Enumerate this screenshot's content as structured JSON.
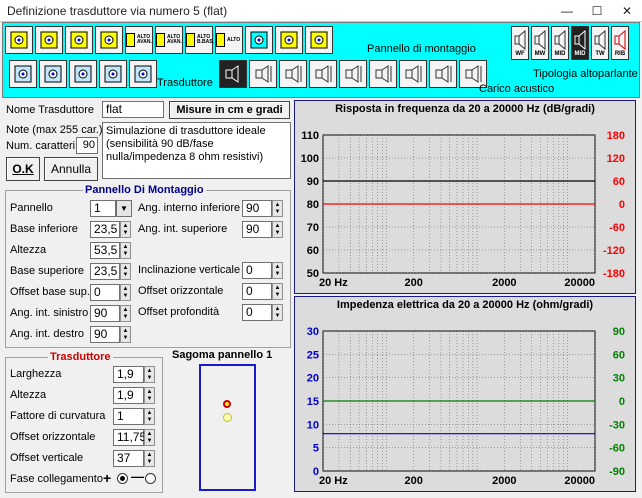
{
  "window": {
    "title": "Definizione trasduttore via numero 5 (flat)",
    "min": "—",
    "max": "☐",
    "close": "✕"
  },
  "toolbar": {
    "mount_label": "Pannello di montaggio",
    "transducer_label": "Trasduttore",
    "acoustic_label": "Carico acustico",
    "type_label": "Tipologia altoparlante",
    "mount_buttons": [
      {
        "icon": "panel-offset-icon",
        "text": ""
      },
      {
        "icon": "panel-center-icon",
        "text": ""
      },
      {
        "icon": "panel-corner-icon",
        "text": ""
      },
      {
        "icon": "panel-corner-left-icon",
        "text": ""
      },
      {
        "icon": "panel-alto-avanzato-icon",
        "text": "ALTO\nAVAN."
      },
      {
        "icon": "panel-alto-avanzato-2-icon",
        "text": "ALTO\nAVAN."
      },
      {
        "icon": "panel-alto-bassi-icon",
        "text": "ALTO\nB.BAS."
      },
      {
        "icon": "panel-alto-3-icon",
        "text": "ALTO"
      },
      {
        "icon": "panel-angle-icon",
        "text": ""
      },
      {
        "icon": "panel-tilt-icon",
        "text": ""
      },
      {
        "icon": "panel-box-icon",
        "text": ""
      }
    ],
    "transducer_buttons": [
      "driver-offset-icon",
      "driver-resize-icon",
      "driver-circle-icon",
      "driver-move-icon",
      "driver-center-icon"
    ],
    "acoustic_buttons": [
      "load-box-icon",
      "load-flat-icon",
      "load-front-icon",
      "load-rear-icon",
      "load-dipole-icon",
      "load-horn-icon",
      "load-ported-icon",
      "load-multi-icon",
      "load-line-icon"
    ],
    "type_buttons": [
      {
        "icon": "woofer-icon",
        "text": "WF"
      },
      {
        "icon": "midwoofer-icon",
        "text": "MW"
      },
      {
        "icon": "midrange-icon",
        "text": "MID"
      },
      {
        "icon": "midrange-sel-icon",
        "text": "MID"
      },
      {
        "icon": "tweeter-icon",
        "text": "TW"
      },
      {
        "icon": "ribbon-icon",
        "text": "RIB"
      }
    ]
  },
  "name_section": {
    "name_label": "Nome Trasduttore",
    "name_value": "flat",
    "units_label": "Misure in cm e gradi",
    "note_label": "Note (max 255 car.)",
    "chars_label": "Num. caratteri",
    "chars_value": "90",
    "note_text": "Simulazione di trasduttore ideale (sensibilità 90 dB/fase nulla/impedenza 8 ohm resistivi)",
    "ok_label": "O.K",
    "cancel_label": "Annulla"
  },
  "mount_panel": {
    "title": "Pannello Di Montaggio",
    "left": [
      {
        "label": "Pannello",
        "value": "1"
      },
      {
        "label": "Base inferiore",
        "value": "23,5"
      },
      {
        "label": "Altezza",
        "value": "53,5"
      },
      {
        "label": "Base superiore",
        "value": "23,5"
      },
      {
        "label": "Offset base sup.",
        "value": "0"
      },
      {
        "label": "Ang. int. sinistro",
        "value": "90"
      },
      {
        "label": "Ang. int. destro",
        "value": "90"
      }
    ],
    "right": [
      {
        "label": "Ang. interno inferiore",
        "value": "90"
      },
      {
        "label": "Ang. int. superiore",
        "value": "90"
      },
      {
        "label": "Inclinazione verticale",
        "value": "0"
      },
      {
        "label": "Offset orizzontale",
        "value": "0"
      },
      {
        "label": "Offset profondità",
        "value": "0"
      }
    ]
  },
  "transducer_panel": {
    "title": "Trasduttore",
    "rows": [
      {
        "label": "Larghezza",
        "value": "1,9"
      },
      {
        "label": "Altezza",
        "value": "1,9"
      },
      {
        "label": "Fattore di curvatura",
        "value": "1"
      },
      {
        "label": "Offset orizzontale",
        "value": "11,75"
      },
      {
        "label": "Offset verticale",
        "value": "37"
      }
    ],
    "phase_label": "Fase collegamento",
    "plus": "+",
    "minus": "—",
    "phase_selected": "+"
  },
  "silhouette": {
    "title": "Sagoma pannello 1"
  },
  "chart_data": [
    {
      "type": "line",
      "title": "Risposta in frequenza da 20 a 20000 Hz (dB/gradi)",
      "xscale": "log",
      "xlim": [
        20,
        20000
      ],
      "x_ticks": [
        {
          "v": 20,
          "label": "20 Hz"
        },
        {
          "v": 200,
          "label": "200"
        },
        {
          "v": 2000,
          "label": "2000"
        },
        {
          "v": 20000,
          "label": "20000"
        }
      ],
      "left_ticks": [
        "110",
        "100",
        "90",
        "80",
        "70",
        "60",
        "50"
      ],
      "right_ticks": [
        "180",
        "120",
        "60",
        "0",
        "-60",
        "-120",
        "-180"
      ],
      "ylim_left": [
        50,
        110
      ],
      "ylim_right": [
        -180,
        180
      ],
      "left_color": "#000000",
      "right_color": "#ff0000",
      "series": [
        {
          "axis": "left",
          "color": "#000000",
          "x": [
            20,
            20000
          ],
          "y": [
            90,
            90
          ]
        },
        {
          "axis": "right",
          "color": "#ff0000",
          "x": [
            20,
            20000
          ],
          "y": [
            0,
            0
          ]
        }
      ]
    },
    {
      "type": "line",
      "title": "Impedenza elettrica da 20 a 20000 Hz (ohm/gradi)",
      "xscale": "log",
      "xlim": [
        20,
        20000
      ],
      "x_ticks": [
        {
          "v": 20,
          "label": "20 Hz"
        },
        {
          "v": 200,
          "label": "200"
        },
        {
          "v": 2000,
          "label": "2000"
        },
        {
          "v": 20000,
          "label": "20000"
        }
      ],
      "left_ticks": [
        "30",
        "25",
        "20",
        "15",
        "10",
        "5",
        "0"
      ],
      "right_ticks": [
        "90",
        "60",
        "30",
        "0",
        "-30",
        "-60",
        "-90"
      ],
      "ylim_left": [
        0,
        30
      ],
      "ylim_right": [
        -90,
        90
      ],
      "left_color": "#0000cc",
      "right_color": "#008000",
      "series": [
        {
          "axis": "left",
          "color": "#0000cc",
          "x": [
            20,
            20000
          ],
          "y": [
            8,
            8
          ]
        },
        {
          "axis": "right",
          "color": "#008000",
          "x": [
            20,
            20000
          ],
          "y": [
            0,
            0
          ]
        }
      ]
    }
  ]
}
